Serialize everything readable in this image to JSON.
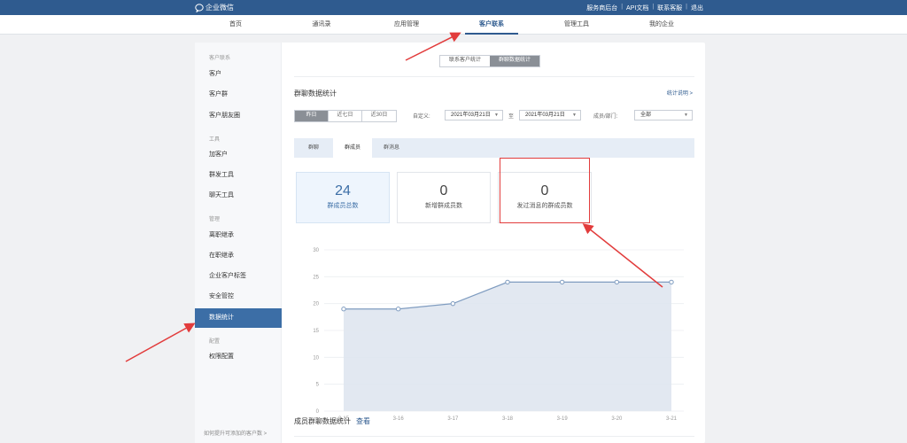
{
  "topbar": {
    "logo": "企业微信",
    "links": [
      "服务商后台",
      "API文档",
      "联系客服",
      "退出"
    ]
  },
  "nav": {
    "items": [
      {
        "label": "首页",
        "active": false
      },
      {
        "label": "通讯录",
        "active": false
      },
      {
        "label": "应用管理",
        "active": false
      },
      {
        "label": "客户联系",
        "active": true
      },
      {
        "label": "管理工具",
        "active": false
      },
      {
        "label": "我的企业",
        "active": false
      }
    ]
  },
  "sidebar": {
    "groups": [
      {
        "title": "客户联系",
        "items": [
          "客户",
          "客户群",
          "客户朋友圈"
        ]
      },
      {
        "title": "工具",
        "items": [
          "加客户",
          "群发工具",
          "聊天工具"
        ]
      },
      {
        "title": "管理",
        "items": [
          "离职继承",
          "在职继承",
          "企业客户标签",
          "安全管控",
          "数据统计"
        ]
      },
      {
        "title": "配置",
        "items": [
          "权限配置"
        ]
      }
    ],
    "active_item": "数据统计",
    "bottom_link": "如何提升可添加的客户数 >"
  },
  "segment": {
    "options": [
      "联系客户统计",
      "群聊数据统计"
    ],
    "active_index": 1
  },
  "section": {
    "title": "群聊数据统计",
    "help": "统计说明 >"
  },
  "filters": {
    "date_buttons": [
      "昨日",
      "近七日",
      "近30日"
    ],
    "date_active_index": 0,
    "custom_label": "自定义:",
    "start_date": "2021年03月21日",
    "to_label": "至",
    "end_date": "2021年03月21日",
    "member_label": "成员/部门:",
    "member_value": "全部"
  },
  "subtabs": {
    "items": [
      "群聊",
      "群成员",
      "群消息"
    ],
    "active_index": 1
  },
  "cards": [
    {
      "value": "24",
      "caption": "群成员总数",
      "highlight": true
    },
    {
      "value": "0",
      "caption": "新增群成员数",
      "highlight": false
    },
    {
      "value": "0",
      "caption": "发过消息的群成员数",
      "highlight": false
    }
  ],
  "chart_data": {
    "type": "area",
    "x": [
      "3-15",
      "3-16",
      "3-17",
      "3-18",
      "3-19",
      "3-20",
      "3-21"
    ],
    "values": [
      19,
      19,
      20,
      24,
      24,
      24,
      24
    ],
    "yticks": [
      0,
      5,
      10,
      15,
      20,
      25,
      30
    ],
    "ylim": [
      0,
      30
    ],
    "grid": true,
    "line_color": "#7f9cc0",
    "fill_color": "#dfe6ef"
  },
  "bottom": {
    "title": "成员群聊数据统计",
    "link": "查看"
  },
  "colors": {
    "brand": "#2f5b8f",
    "annotation": "#e23c3c"
  }
}
